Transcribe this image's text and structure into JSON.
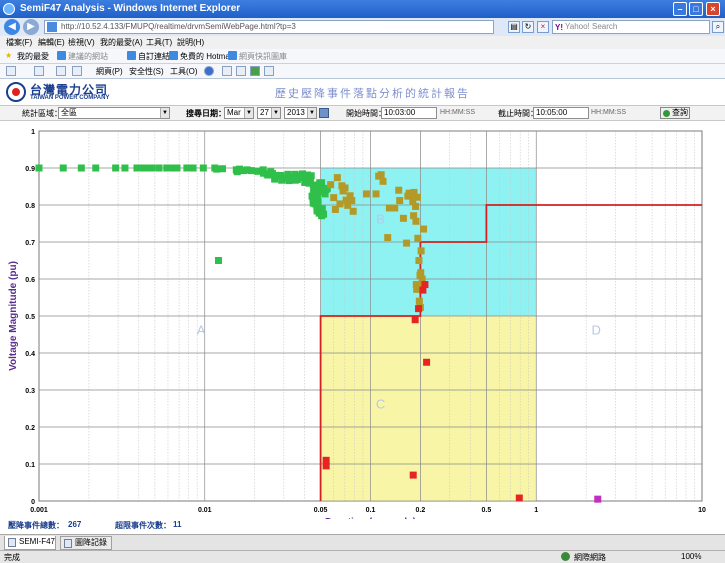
{
  "window": {
    "title": "SemiF47 Analysis - Windows Internet Explorer"
  },
  "browser": {
    "address": "http://10.52.4.133/FMUPQ/realtime/drvmSemiWebPage.html?tp=3",
    "search_placeholder": "Yahoo! Search",
    "menu": [
      "檔案(F)",
      "編輯(E)",
      "檢視(V)",
      "我的最愛(A)",
      "工具(T)",
      "說明(H)"
    ],
    "favorites": {
      "my_favorites": "我的最愛",
      "suggested": "建議的網站",
      "custom": "自訂連結",
      "hotmail": "免費的 Hotmail",
      "web_slice": "網頁快訊圖庫"
    },
    "commands": {
      "page": "網頁(P)",
      "safety": "安全性(S)",
      "tools": "工具(O)"
    }
  },
  "header": {
    "company_zh": "台灣電力公司",
    "company_en": "TAIWAN POWER COMPANY",
    "report_title": "歷史壓降事件落點分析的統計報告"
  },
  "filters": {
    "region_label": "統計區域：",
    "region_value": "全區",
    "date_label": "搜尋日期：",
    "month": "Mar",
    "day": "27",
    "year": "2013",
    "start_label": "開始時間：",
    "start_time": "10:03:00",
    "start_format": "HH:MM:SS",
    "end_label": "截止時間：",
    "end_time": "10:05:00",
    "end_format": "HH:MM:SS",
    "query_button": "查詢"
  },
  "footer": {
    "total_label": "壓降事件總數：",
    "total_value": "267",
    "exceed_label": "超限事件次數：",
    "exceed_value": "11"
  },
  "tabs": [
    "SEMI-F47",
    "圖降記錄"
  ],
  "status": {
    "left": "完成",
    "zone": "網際網路",
    "zoom": "100%"
  },
  "chart_data": {
    "type": "scatter",
    "xscale": "log",
    "xlim": [
      0.001,
      10
    ],
    "ylim": [
      0,
      1
    ],
    "xlabel": "Duration (seconds)",
    "ylabel": "Voltage Magnitude (pu)",
    "xticks": [
      "0.001",
      "0.01",
      "0.05",
      "0.1",
      "0.2",
      "0.5",
      "1",
      "10"
    ],
    "xtick_values": [
      0.001,
      0.01,
      0.05,
      0.1,
      0.2,
      0.5,
      1,
      10
    ],
    "yticks": [
      "0",
      "0.1",
      "0.2",
      "0.3",
      "0.4",
      "0.5",
      "0.6",
      "0.7",
      "0.8",
      "0.9",
      "1"
    ],
    "ytick_values": [
      0,
      0.1,
      0.2,
      0.3,
      0.4,
      0.5,
      0.6,
      0.7,
      0.8,
      0.9,
      1.0
    ],
    "grid": true,
    "colors": {
      "region_b": "#8ef2f2",
      "region_c": "#f8f6a6",
      "curve": "#d42020",
      "green": "#2fbf4a",
      "olive": "#b39a28",
      "red": "#e62424",
      "magenta": "#c030c0",
      "label": "#b8c8e8"
    },
    "regions": [
      {
        "name": "B",
        "x": [
          0.05,
          1
        ],
        "y": [
          0.5,
          0.9
        ]
      },
      {
        "name": "C",
        "x": [
          0.05,
          1
        ],
        "y": [
          0,
          0.5
        ]
      }
    ],
    "curve": [
      [
        0.05,
        0
      ],
      [
        0.05,
        0.5
      ],
      [
        0.2,
        0.5
      ],
      [
        0.2,
        0.7
      ],
      [
        0.5,
        0.7
      ],
      [
        0.5,
        0.8
      ],
      [
        10,
        0.8
      ]
    ],
    "region_labels": [
      {
        "text": "A",
        "x": 0.0095,
        "y": 0.45
      },
      {
        "text": "B",
        "x": 0.115,
        "y": 0.75
      },
      {
        "text": "C",
        "x": 0.115,
        "y": 0.25
      },
      {
        "text": "D",
        "x": 2.3,
        "y": 0.45
      }
    ],
    "series": [
      {
        "name": "",
        "color": "green",
        "points": [
          [
            0.001,
            0.9
          ],
          [
            0.0014,
            0.9
          ],
          [
            0.0018,
            0.9
          ],
          [
            0.0022,
            0.9
          ],
          [
            0.0029,
            0.9
          ],
          [
            0.0033,
            0.9
          ],
          [
            0.0039,
            0.9
          ],
          [
            0.0042,
            0.9
          ],
          [
            0.0045,
            0.9
          ],
          [
            0.0048,
            0.9
          ],
          [
            0.0053,
            0.9
          ],
          [
            0.0059,
            0.9
          ],
          [
            0.0063,
            0.9
          ],
          [
            0.0068,
            0.9
          ],
          [
            0.0078,
            0.9
          ],
          [
            0.0085,
            0.9
          ],
          [
            0.0098,
            0.9
          ],
          [
            0.0115,
            0.9
          ],
          [
            0.0118,
            0.897
          ],
          [
            0.0128,
            0.898
          ],
          [
            0.0155,
            0.895
          ],
          [
            0.0157,
            0.89
          ],
          [
            0.0162,
            0.897
          ],
          [
            0.0172,
            0.893
          ],
          [
            0.018,
            0.895
          ],
          [
            0.0191,
            0.893
          ],
          [
            0.0208,
            0.891
          ],
          [
            0.0225,
            0.895
          ],
          [
            0.0226,
            0.886
          ],
          [
            0.0238,
            0.884
          ],
          [
            0.024,
            0.881
          ],
          [
            0.025,
            0.89
          ],
          [
            0.0256,
            0.885
          ],
          [
            0.0264,
            0.87
          ],
          [
            0.027,
            0.88
          ],
          [
            0.0288,
            0.88
          ],
          [
            0.0291,
            0.867
          ],
          [
            0.031,
            0.872
          ],
          [
            0.0318,
            0.883
          ],
          [
            0.0322,
            0.866
          ],
          [
            0.0332,
            0.874
          ],
          [
            0.0351,
            0.883
          ],
          [
            0.0352,
            0.867
          ],
          [
            0.0362,
            0.869
          ],
          [
            0.0374,
            0.874
          ],
          [
            0.0383,
            0.879
          ],
          [
            0.0389,
            0.884
          ],
          [
            0.0401,
            0.861
          ],
          [
            0.0416,
            0.867
          ],
          [
            0.0416,
            0.881
          ],
          [
            0.0417,
            0.881
          ],
          [
            0.0425,
            0.859
          ],
          [
            0.0428,
            0.878
          ],
          [
            0.0434,
            0.87
          ],
          [
            0.0439,
            0.879
          ],
          [
            0.0444,
            0.824
          ],
          [
            0.045,
            0.816
          ],
          [
            0.0451,
            0.805
          ],
          [
            0.0452,
            0.854
          ],
          [
            0.0454,
            0.834
          ],
          [
            0.0455,
            0.84
          ],
          [
            0.0457,
            0.848
          ],
          [
            0.0464,
            0.803
          ],
          [
            0.0471,
            0.811
          ],
          [
            0.0475,
            0.79
          ],
          [
            0.0476,
            0.784
          ],
          [
            0.048,
            0.82
          ],
          [
            0.0482,
            0.8
          ],
          [
            0.0483,
            0.808
          ],
          [
            0.0485,
            0.846
          ],
          [
            0.049,
            0.778
          ],
          [
            0.0497,
            0.836
          ],
          [
            0.0494,
            0.86
          ],
          [
            0.0505,
            0.78
          ],
          [
            0.0507,
            0.86
          ],
          [
            0.0507,
            0.771
          ],
          [
            0.0512,
            0.79
          ],
          [
            0.0521,
            0.775
          ],
          [
            0.0526,
            0.842
          ],
          [
            0.0532,
            0.83
          ],
          [
            0.054,
            0.842
          ],
          [
            0.0549,
            0.845
          ],
          [
            0.0121,
            0.65
          ]
        ]
      },
      {
        "name": "",
        "color": "olive",
        "points": [
          [
            0.0575,
            0.855
          ],
          [
            0.06,
            0.82
          ],
          [
            0.0614,
            0.788
          ],
          [
            0.0631,
            0.874
          ],
          [
            0.0654,
            0.803
          ],
          [
            0.0672,
            0.852
          ],
          [
            0.0683,
            0.838
          ],
          [
            0.0702,
            0.846
          ],
          [
            0.0713,
            0.813
          ],
          [
            0.0729,
            0.799
          ],
          [
            0.0753,
            0.825
          ],
          [
            0.0771,
            0.812
          ],
          [
            0.0786,
            0.783
          ],
          [
            0.0945,
            0.83
          ],
          [
            0.108,
            0.83
          ],
          [
            0.112,
            0.878
          ],
          [
            0.116,
            0.882
          ],
          [
            0.119,
            0.864
          ],
          [
            0.127,
            0.712
          ],
          [
            0.13,
            0.792
          ],
          [
            0.14,
            0.792
          ],
          [
            0.148,
            0.84
          ],
          [
            0.15,
            0.812
          ],
          [
            0.158,
            0.764
          ],
          [
            0.165,
            0.697
          ],
          [
            0.168,
            0.824
          ],
          [
            0.171,
            0.832
          ],
          [
            0.176,
            0.824
          ],
          [
            0.18,
            0.81
          ],
          [
            0.182,
            0.771
          ],
          [
            0.183,
            0.834
          ],
          [
            0.187,
            0.796
          ],
          [
            0.188,
            0.756
          ],
          [
            0.189,
            0.585
          ],
          [
            0.19,
            0.572
          ],
          [
            0.192,
            0.821
          ],
          [
            0.193,
            0.71
          ],
          [
            0.196,
            0.65
          ],
          [
            0.197,
            0.54
          ],
          [
            0.199,
            0.61
          ],
          [
            0.2,
            0.523
          ],
          [
            0.201,
            0.617
          ],
          [
            0.202,
            0.676
          ],
          [
            0.203,
            0.583
          ],
          [
            0.205,
            0.6
          ],
          [
            0.209,
            0.735
          ]
        ]
      },
      {
        "name": "",
        "color": "red",
        "points": [
          [
            0.054,
            0.11
          ],
          [
            0.054,
            0.095
          ],
          [
            0.181,
            0.07
          ],
          [
            0.186,
            0.49
          ],
          [
            0.195,
            0.52
          ],
          [
            0.207,
            0.57
          ],
          [
            0.213,
            0.585
          ],
          [
            0.218,
            0.375
          ],
          [
            0.79,
            0.008
          ]
        ]
      },
      {
        "name": "",
        "color": "magenta",
        "points": [
          [
            2.35,
            0.005
          ]
        ]
      }
    ]
  }
}
